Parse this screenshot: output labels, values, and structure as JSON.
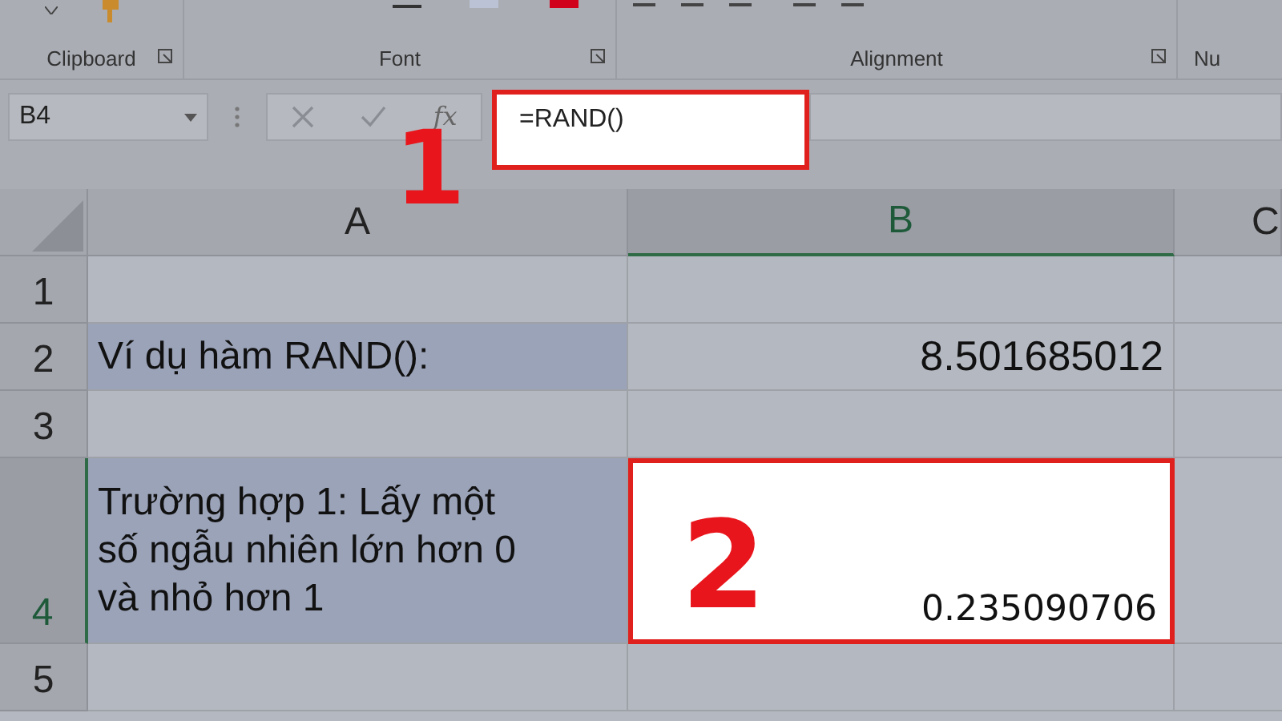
{
  "ribbon": {
    "groups": [
      {
        "label": "Clipboard"
      },
      {
        "label": "Font"
      },
      {
        "label": "Alignment"
      },
      {
        "label": "Nu"
      }
    ]
  },
  "formula_bar": {
    "name_box": "B4",
    "function_label": "fx",
    "formula": "=RAND()"
  },
  "annotations": [
    {
      "text": "1"
    }
  ],
  "columns": [
    {
      "label": "A",
      "selected": false
    },
    {
      "label": "B",
      "selected": true
    },
    {
      "label": "C",
      "selected": false
    }
  ],
  "rows": [
    {
      "label": "1",
      "selected": false,
      "tall": false
    },
    {
      "label": "2",
      "selected": false,
      "tall": false,
      "column_a": {
        "text": "Ví dụ hàm RAND():",
        "filled": true
      },
      "column_b": {
        "text": "8.501685012",
        "active": false
      }
    },
    {
      "label": "3",
      "selected": false,
      "tall": false
    },
    {
      "label": "4",
      "selected": true,
      "tall": true,
      "column_a": {
        "text": "Trường hợp 1: Lấy một số ngẫu nhiên lớn hơn 0 và nhỏ hơn 1",
        "filled": true
      },
      "column_b": {
        "text": "0.235090706",
        "active": true,
        "annotation": "2"
      }
    },
    {
      "label": "5",
      "selected": false,
      "tall": false
    }
  ]
}
